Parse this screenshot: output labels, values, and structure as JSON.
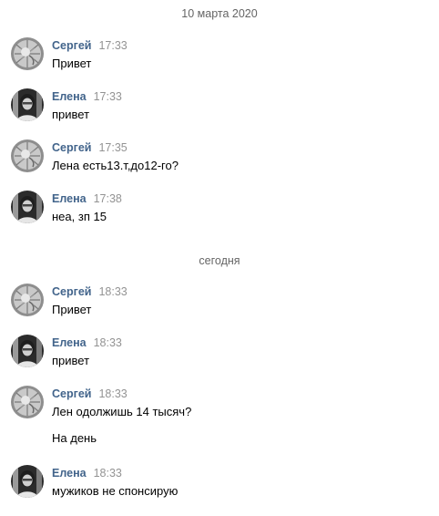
{
  "dates": {
    "first": "10 марта 2020",
    "second": "сегодня"
  },
  "messages": [
    {
      "author": "Сергей",
      "time": "17:33",
      "text": "Привет",
      "avatar_icon": "sergey-avatar"
    },
    {
      "author": "Елена",
      "time": "17:33",
      "text": "привет",
      "avatar_icon": "elena-avatar"
    },
    {
      "author": "Сергей",
      "time": "17:35",
      "text": "Лена есть13.т,до12-го?",
      "avatar_icon": "sergey-avatar"
    },
    {
      "author": "Елена",
      "time": "17:38",
      "text": "неа, зп 15",
      "avatar_icon": "elena-avatar"
    },
    {
      "author": "Сергей",
      "time": "18:33",
      "text": "Привет",
      "avatar_icon": "sergey-avatar"
    },
    {
      "author": "Елена",
      "time": "18:33",
      "text": "привет",
      "avatar_icon": "elena-avatar"
    },
    {
      "author": "Сергей",
      "time": "18:33",
      "text": "Лен одолжишь 14 тысяч?",
      "extra_text": "На день",
      "avatar_icon": "sergey-avatar"
    },
    {
      "author": "Елена",
      "time": "18:33",
      "text": "мужиков не спонсирую",
      "avatar_icon": "elena-avatar"
    }
  ],
  "colors": {
    "author": "#42648b",
    "time": "#939393",
    "date_separator": "#656565",
    "text": "#000000"
  }
}
